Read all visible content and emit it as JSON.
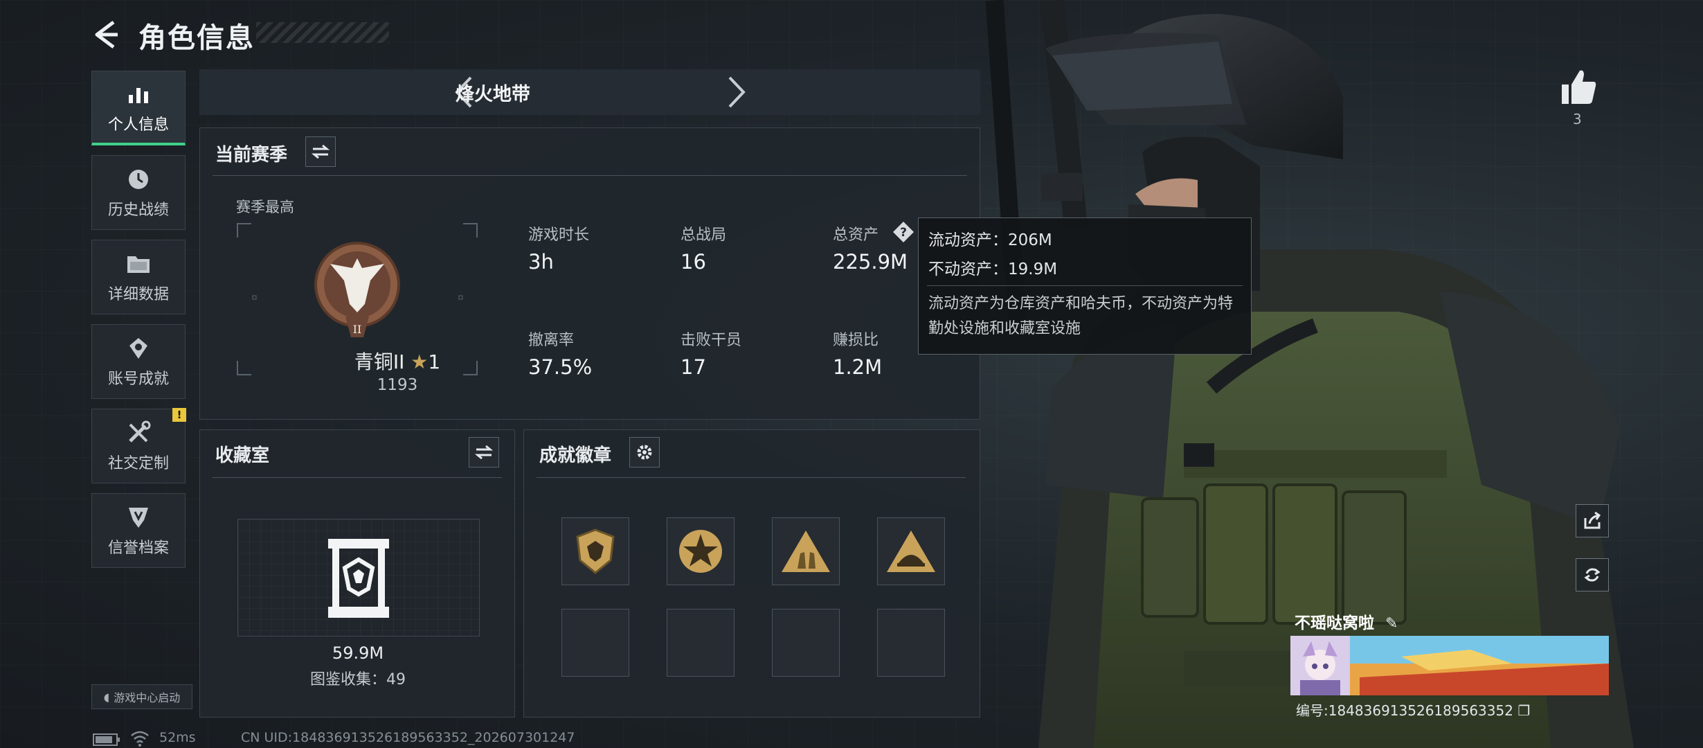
{
  "header": {
    "title": "角色信息"
  },
  "nav": {
    "items": [
      {
        "label": "个人信息",
        "icon": "bar-chart-icon",
        "active": true
      },
      {
        "label": "历史战绩",
        "icon": "history-icon"
      },
      {
        "label": "详细数据",
        "icon": "folder-icon"
      },
      {
        "label": "账号成就",
        "icon": "achievement-icon"
      },
      {
        "label": "社交定制",
        "icon": "tools-icon",
        "badge": "!"
      },
      {
        "label": "信誉档案",
        "icon": "credit-shield-icon"
      }
    ],
    "launch_label": "游戏中心启动"
  },
  "mode": {
    "name": "烽火地带"
  },
  "season": {
    "title": "当前赛季",
    "best_label": "赛季最高",
    "rank_name": "青铜II",
    "rank_stars": "1",
    "rank_score": "1193",
    "stats": [
      {
        "label": "游戏时长",
        "value": "3h"
      },
      {
        "label": "总战局",
        "value": "16"
      },
      {
        "label": "总资产",
        "value": "225.9M"
      },
      {
        "label": "撤离率",
        "value": "37.5%"
      },
      {
        "label": "击败干员",
        "value": "17"
      },
      {
        "label": "赚损比",
        "value": "1.2M"
      }
    ]
  },
  "tooltip": {
    "liquid": "流动资产：206M",
    "fixed": "不动资产：19.9M",
    "desc": "流动资产为仓库资产和哈夫币，不动资产为特勤处设施和收藏室设施"
  },
  "collection": {
    "title": "收藏室",
    "value": "59.9M",
    "catalog": "图鉴收集：49"
  },
  "badges": {
    "title": "成就徽章"
  },
  "player": {
    "likes": "3",
    "name": "不瑶哒窝啦",
    "id_text": "编号:1848369135261895633​52"
  },
  "status": {
    "ping": "52ms",
    "uid": "CN UID:1848369135261895633​52_202607301247"
  },
  "colors": {
    "accent": "#3fd08a",
    "badge_gold": "#c9a35a",
    "warning": "#e9c63b"
  }
}
